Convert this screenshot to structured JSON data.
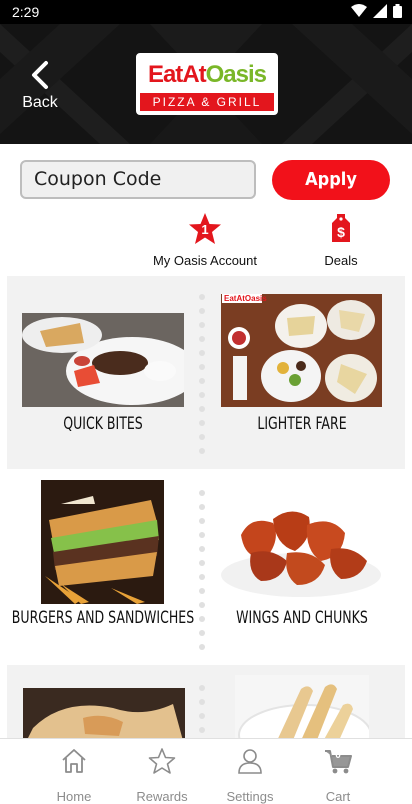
{
  "status_bar": {
    "time": "2:29"
  },
  "header": {
    "back_label": "Back",
    "logo": {
      "word1": "Eat",
      "word2": "At",
      "word3": "Oasis",
      "tagline": "PIZZA & GRILL"
    }
  },
  "coupon": {
    "placeholder": "Coupon Code",
    "apply_label": "Apply"
  },
  "quick_links": {
    "account_label": "My Oasis Account",
    "account_badge": "1",
    "deals_label": "Deals",
    "deals_icon_glyph": "$"
  },
  "menu": {
    "categories": [
      {
        "label": "QUICK BITES"
      },
      {
        "label": "LIGHTER FARE"
      },
      {
        "label": "BURGERS AND SANDWICHES"
      },
      {
        "label": "WINGS AND CHUNKS"
      }
    ],
    "mini_logo": "EatAtOasis"
  },
  "bottom_nav": {
    "home": "Home",
    "rewards": "Rewards",
    "settings": "Settings",
    "cart": "Cart",
    "cart_count": "0"
  },
  "colors": {
    "accent_red": "#f2111a",
    "brand_green": "#7ab728",
    "nav_gray": "#8c8c8c"
  }
}
